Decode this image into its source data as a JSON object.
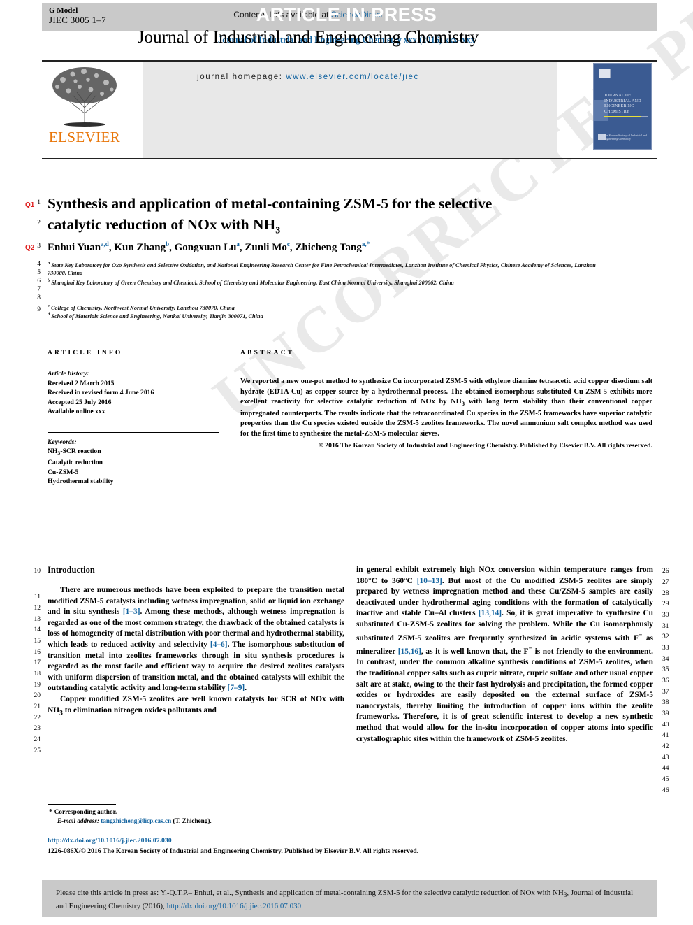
{
  "header": {
    "g_model_label": "G Model",
    "manuscript_id": "JIEC 3005 1–7",
    "article_in_press": "ARTICLE IN PRESS",
    "running_head": "Journal of Industrial and Engineering Chemistry xxx (2016) xxx–xxx"
  },
  "masthead": {
    "contents_prefix": "Contents lists available at ",
    "contents_link": "ScienceDirect",
    "journal_title": "Journal of Industrial and Engineering Chemistry",
    "homepage_prefix": "journal homepage: ",
    "homepage_url": "www.elsevier.com/locate/jiec",
    "publisher_wordmark": "ELSEVIER",
    "cover_title": "JOURNAL OF INDUSTRIAL AND ENGINEERING CHEMISTRY",
    "cover_footer": "The Korean Society of Industrial and Engineering Chemistry"
  },
  "article": {
    "q1_tag": "Q1",
    "q2_tag": "Q2",
    "title_line1": "Synthesis and application of metal-containing ZSM-5 for the selective",
    "title_line2_a": "catalytic reduction of NOx with NH",
    "title_line2_sub": "3",
    "authors": "Enhui Yuan",
    "author_list": [
      {
        "name": "Enhui Yuan",
        "sup": "a,d"
      },
      {
        "name": "Kun Zhang",
        "sup": "b"
      },
      {
        "name": "Gongxuan Lu",
        "sup": "a"
      },
      {
        "name": "Zunli Mo",
        "sup": "c"
      },
      {
        "name": "Zhicheng Tang",
        "sup": "a,*"
      }
    ],
    "affiliations": [
      {
        "marker": "a",
        "text": "State Key Laboratory for Oxo Synthesis and Selective Oxidation, and National Engineering Research Center for Fine Petrochemical Intermediates, Lanzhou Institute of Chemical Physics, Chinese Academy of Sciences, Lanzhou 730000, China"
      },
      {
        "marker": "b",
        "text": "Shanghai Key Laboratory of Green Chemistry and Chemical, School of Chemistry and Molecular Engineering, East China Normal University, Shanghai 200062, China"
      },
      {
        "marker": "c",
        "text": "College of Chemistry, Northwest Normal University, Lanzhou 730070, China"
      },
      {
        "marker": "d",
        "text": "School of Materials Science and Engineering, Nankai University, Tianjin 300071, China"
      }
    ]
  },
  "article_info": {
    "heading": "ARTICLE INFO",
    "history_label": "Article history:",
    "history": [
      "Received 2 March 2015",
      "Received in revised form 4 June 2016",
      "Accepted 25 July 2016",
      "Available online xxx"
    ],
    "keywords_label": "Keywords:",
    "keywords": [
      "NH3-SCR reaction",
      "Catalytic reduction",
      "Cu-ZSM-5",
      "Hydrothermal stability"
    ]
  },
  "abstract": {
    "heading": "ABSTRACT",
    "body": "We reported a new one-pot method to synthesize Cu incorporated ZSM-5 with ethylene diamine tetraacetic acid copper disodium salt hydrate (EDTA-Cu) as copper source by a hydrothermal process. The obtained isomorphous substituted Cu-ZSM-5 exhibits more excellent reactivity for selective catalytic reduction of NOx by NH3 with long term stability than their conventional copper impregnated counterparts. The results indicate that the tetracoordinated Cu species in the ZSM-5 frameworks have superior catalytic properties than the Cu species existed outside the ZSM-5 zeolites frameworks. The novel ammonium salt complex method was used for the first time to synthesize the metal-ZSM-5 molecular sieves.",
    "copyright": "© 2016 The Korean Society of Industrial and Engineering Chemistry. Published by Elsevier B.V. All rights reserved."
  },
  "body": {
    "section_heading": "Introduction",
    "left_paragraph_1": "There are numerous methods have been exploited to prepare the transition metal modified ZSM-5 catalysts including wetness impregnation, solid or liquid ion exchange and in situ synthesis [1–3]. Among these methods, although wetness impregnation is regarded as one of the most common strategy, the drawback of the obtained catalysts is loss of homogeneity of metal distribution with poor thermal and hydrothermal stability, which leads to reduced activity and selectivity [4–6]. The isomorphous substitution of transition metal into zeolites frameworks through in situ synthesis procedures is regarded as the most facile and efficient way to acquire the desired zeolites catalysts with uniform dispersion of transition metal, and the obtained catalysts will exhibit the outstanding catalytic activity and long-term stability [7–9].",
    "left_paragraph_2": "Copper modified ZSM-5 zeolites are well known catalysts for SCR of NOx with NH3 to elimination nitrogen oxides pollutants and",
    "right_paragraph_1": "in general exhibit extremely high NOx conversion within temperature ranges from 180°C to 360°C [10–13]. But most of the Cu modified ZSM-5 zeolites are simply prepared by wetness impregnation method and these Cu/ZSM-5 samples are easily deactivated under hydrothermal aging conditions with the formation of catalytically inactive and stable Cu–Al clusters [13,14]. So, it is great imperative to synthesize Cu substituted Cu-ZSM-5 zeolites for solving the problem. While the Cu isomorphously substituted ZSM-5 zeolites are frequently synthesized in acidic systems with F⁻ as mineralizer [15,16], as it is well known that, the F⁻ is not friendly to the environment. In contrast, under the common alkaline synthesis conditions of ZSM-5 zeolites, when the traditional copper salts such as cupric nitrate, cupric sulfate and other usual copper salt are at stake, owing to the their fast hydrolysis and precipitation, the formed copper oxides or hydroxides are easily deposited on the external surface of ZSM-5 nanocrystals, thereby limiting the introduction of copper ions within the zeolite frameworks. Therefore, it is of great scientific interest to develop a new synthetic method that would allow for the in-situ incorporation of copper atoms into specific crystallographic sites within the framework of ZSM-5 zeolites."
  },
  "footnote": {
    "star": "*",
    "corresponding": "Corresponding author.",
    "email_label": "E-mail address:",
    "email": "tangzhicheng@licp.cas.cn",
    "email_owner": "(T. Zhicheng)."
  },
  "footer": {
    "doi": "http://dx.doi.org/10.1016/j.jiec.2016.07.030",
    "issn_copyright": "1226-086X/© 2016 The Korean Society of Industrial and Engineering Chemistry. Published by Elsevier B.V. All rights reserved."
  },
  "cite_box": {
    "text_part1": "Please cite this article in press as: Y.-Q.T.P.– Enhui, et al., Synthesis and application of metal-containing ZSM-5 for the selective catalytic reduction of NOx with NH",
    "sub": "3",
    "text_part2": ", Journal of Industrial and Engineering Chemistry (2016), ",
    "link": "http://dx.doi.org/10.1016/j.jiec.2016.07.030"
  },
  "watermark": {
    "line1": "UNCORRECTED PROOF"
  },
  "line_numbers": {
    "left_column": [
      "1",
      "2",
      "3",
      "4",
      "5",
      "6",
      "7",
      "8",
      "9",
      "10",
      "11",
      "12",
      "13",
      "14",
      "15",
      "16",
      "17",
      "18",
      "19",
      "20",
      "21",
      "22",
      "23",
      "24",
      "25"
    ],
    "right_column": [
      "26",
      "27",
      "28",
      "29",
      "30",
      "31",
      "32",
      "33",
      "34",
      "35",
      "36",
      "37",
      "38",
      "39",
      "40",
      "41",
      "42",
      "43",
      "44",
      "45",
      "46"
    ]
  },
  "colors": {
    "link": "#1464a0",
    "elsevier_orange": "#e8760a",
    "query_red": "#e02020",
    "band_grey": "#c9c9c9"
  }
}
